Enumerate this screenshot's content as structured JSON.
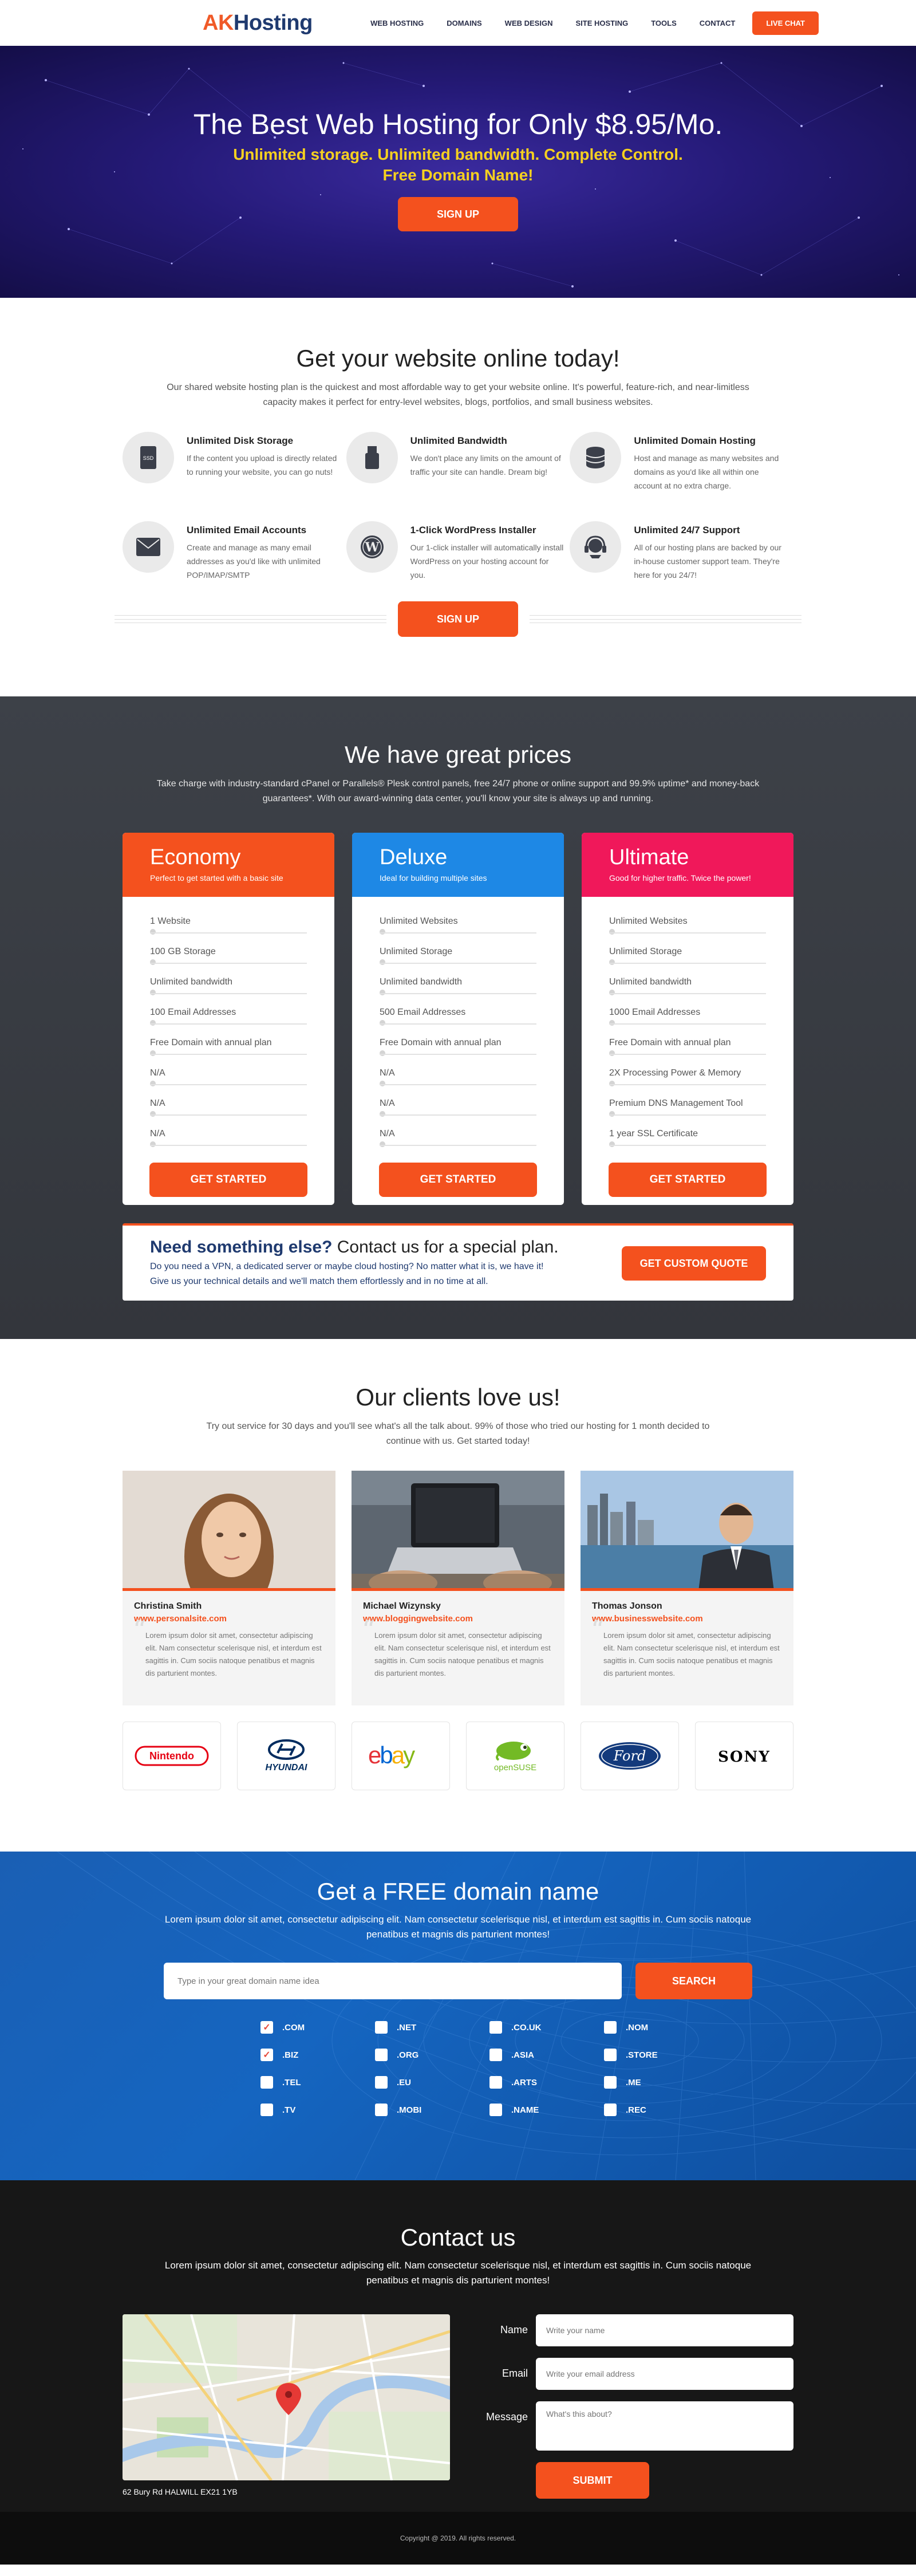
{
  "header": {
    "logo_ak": "AK",
    "logo_rest": "Hosting",
    "nav": [
      "WEB HOSTING",
      "DOMAINS",
      "WEB DESIGN",
      "SITE HOSTING",
      "TOOLS",
      "CONTACT"
    ],
    "live_chat": "LIVE CHAT"
  },
  "hero": {
    "title": "The Best Web Hosting for Only $8.95/Mo.",
    "sub1": "Unlimited storage. Unlimited bandwidth. Complete Control.",
    "sub2": "Free Domain Name!",
    "cta": "SIGN UP"
  },
  "features": {
    "title": "Get your website online today!",
    "intro": "Our shared website hosting plan is the quickest and most affordable way to get your website online. It's powerful, feature-rich, and near-limitless capacity makes it perfect for entry-level websites, blogs, portfolios, and small business websites.",
    "items": [
      {
        "title": "Unlimited Disk Storage",
        "text": "If the content you upload is directly related to running your website, you can go nuts!",
        "icon": "ssd-icon"
      },
      {
        "title": "Unlimited Bandwidth",
        "text": "We don't place any limits on the amount of traffic your site can handle. Dream big!",
        "icon": "usb-icon"
      },
      {
        "title": "Unlimited Domain Hosting",
        "text": "Host and manage as many websites and domains as you'd like all within one account at no extra charge.",
        "icon": "database-icon"
      },
      {
        "title": "Unlimited Email Accounts",
        "text": "Create and manage as many email addresses as you'd like with unlimited POP/IMAP/SMTP",
        "icon": "envelope-icon"
      },
      {
        "title": "1-Click WordPress Installer",
        "text": "Our 1-click installer will automatically install WordPress on your hosting account for you.",
        "icon": "wordpress-icon"
      },
      {
        "title": "Unlimited 24/7 Support",
        "text": "All of our hosting plans are backed by our in-house customer support team. They're here for you 24/7!",
        "icon": "headset-icon"
      }
    ],
    "cta": "SIGN UP"
  },
  "pricing": {
    "title": "We have great prices",
    "intro": "Take charge with industry-standard cPanel or Parallels® Plesk control panels, free 24/7 phone or online support and 99.9% uptime* and money-back guarantees*. With our award-winning data center, you'll know your site is always up and running.",
    "plans": [
      {
        "name": "Economy",
        "tagline": "Perfect to get started with a basic site",
        "color": "#f4511e",
        "features": [
          "1 Website",
          "100 GB Storage",
          "Unlimited bandwidth",
          "100 Email Addresses",
          "Free Domain with annual plan",
          "N/A",
          "N/A",
          "N/A"
        ],
        "cta": "GET STARTED"
      },
      {
        "name": "Deluxe",
        "tagline": "Ideal for building multiple sites",
        "color": "#1e88e5",
        "features": [
          "Unlimited Websites",
          "Unlimited Storage",
          "Unlimited bandwidth",
          "500 Email Addresses",
          "Free Domain with annual plan",
          "N/A",
          "N/A",
          "N/A"
        ],
        "cta": "GET STARTED"
      },
      {
        "name": "Ultimate",
        "tagline": "Good for higher traffic. Twice the power!",
        "color": "#f0185a",
        "features": [
          "Unlimited Websites",
          "Unlimited Storage",
          "Unlimited bandwidth",
          "1000 Email Addresses",
          "Free Domain with annual plan",
          "2X Processing Power & Memory",
          "Premium DNS Management Tool",
          "1 year SSL Certificate"
        ],
        "cta": "GET STARTED"
      }
    ],
    "custom": {
      "title_bold": "Need something else?",
      "title_rest": " Contact us for a special plan.",
      "line1": "Do you need a VPN, a dedicated server or maybe cloud hosting? No matter what it is, we have it!",
      "line2": "Give us your technical details and we'll match them effortlessly and in no time at all.",
      "cta": "GET CUSTOM QUOTE"
    }
  },
  "testimonials": {
    "title": "Our clients love us!",
    "intro": "Try out service for 30 days and you'll see what's all the talk about. 99% of those who tried our hosting for 1 month decided to continue with us. Get started today!",
    "items": [
      {
        "name": "Christina Smith",
        "site": "www.personalsite.com",
        "quote": "Lorem ipsum dolor sit amet, consectetur adipiscing elit. Nam consectetur scelerisque nisl, et interdum est sagittis in. Cum sociis natoque penatibus et magnis dis parturient montes."
      },
      {
        "name": "Michael Wizynsky",
        "site": "www.bloggingwebsite.com",
        "quote": "Lorem ipsum dolor sit amet, consectetur adipiscing elit. Nam consectetur scelerisque nisl, et interdum est sagittis in. Cum sociis natoque penatibus et magnis dis parturient montes."
      },
      {
        "name": "Thomas Jonson",
        "site": "www.businesswebsite.com",
        "quote": "Lorem ipsum dolor sit amet, consectetur adipiscing elit. Nam consectetur scelerisque nisl, et interdum est sagittis in. Cum sociis natoque penatibus et magnis dis parturient montes."
      }
    ],
    "logos": [
      "Nintendo",
      "HYUNDAI",
      "ebay",
      "openSUSE",
      "Ford",
      "SONY"
    ]
  },
  "domain": {
    "title": "Get a FREE domain name",
    "intro": "Lorem ipsum dolor sit amet, consectetur adipiscing elit. Nam consectetur scelerisque nisl, et interdum est sagittis in. Cum sociis natoque penatibus et magnis dis parturient montes!",
    "placeholder": "Type in your great domain name idea",
    "cta": "SEARCH",
    "tlds": [
      {
        "label": ".COM",
        "checked": true
      },
      {
        "label": ".NET",
        "checked": false
      },
      {
        "label": ".CO.UK",
        "checked": false
      },
      {
        "label": ".NOM",
        "checked": false
      },
      {
        "label": ".BIZ",
        "checked": true
      },
      {
        "label": ".ORG",
        "checked": false
      },
      {
        "label": ".ASIA",
        "checked": false
      },
      {
        "label": ".STORE",
        "checked": false
      },
      {
        "label": ".TEL",
        "checked": false
      },
      {
        "label": ".EU",
        "checked": false
      },
      {
        "label": ".ARTS",
        "checked": false
      },
      {
        "label": ".ME",
        "checked": false
      },
      {
        "label": ".TV",
        "checked": false
      },
      {
        "label": ".MOBI",
        "checked": false
      },
      {
        "label": ".NAME",
        "checked": false
      },
      {
        "label": ".REC",
        "checked": false
      }
    ]
  },
  "contact": {
    "title": "Contact us",
    "intro": "Lorem ipsum dolor sit amet, consectetur adipiscing elit. Nam consectetur scelerisque nisl, et interdum est sagittis in. Cum sociis natoque penatibus et magnis dis parturient montes!",
    "address": "62 Bury Rd HALWILL EX21 1YB",
    "labels": {
      "name": "Name",
      "email": "Email",
      "message": "Message"
    },
    "placeholders": {
      "name": "Write your name",
      "email": "Write your email address",
      "message": "What's this about?"
    },
    "submit": "SUBMIT"
  },
  "footer": {
    "copyright": "Copyright @ 2019. All rights reserved."
  }
}
